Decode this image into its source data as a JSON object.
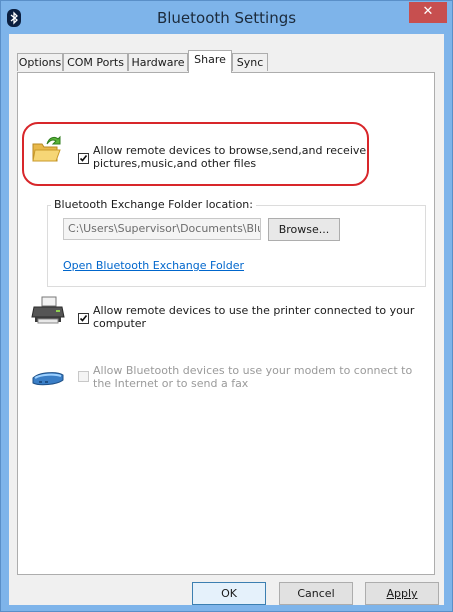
{
  "window": {
    "title": "Bluetooth Settings",
    "close_glyph": "✕"
  },
  "tabs": [
    {
      "label": "Options"
    },
    {
      "label": "COM Ports"
    },
    {
      "label": "Hardware"
    },
    {
      "label": "Share",
      "active": true
    },
    {
      "label": "Sync"
    }
  ],
  "share": {
    "browse_files": {
      "icon": "shared-folder-icon",
      "checked": true,
      "label_line1": "Allow remote devices to browse,send,and receive",
      "label_line2": "pictures,music,and other files"
    },
    "exchange_folder": {
      "group_title": "Bluetooth Exchange Folder location:",
      "path": "C:\\Users\\Supervisor\\Documents\\Bluetooth",
      "browse_label": "Browse...",
      "open_link": "Open Bluetooth Exchange Folder"
    },
    "printer": {
      "icon": "printer-icon",
      "checked": true,
      "label_line1": "Allow remote devices to use the printer connected to your",
      "label_line2": "computer"
    },
    "modem": {
      "icon": "modem-icon",
      "checked": false,
      "enabled": false,
      "label_line1": "Allow Bluetooth devices to use your modem to connect to",
      "label_line2": "the Internet or to send a fax"
    }
  },
  "buttons": {
    "ok": "OK",
    "cancel": "Cancel",
    "apply": "Apply"
  },
  "colors": {
    "title_bar": "#7eb4ea",
    "close_button": "#c74f4f",
    "highlight_ring": "#d8262a",
    "link": "#0066cc"
  }
}
